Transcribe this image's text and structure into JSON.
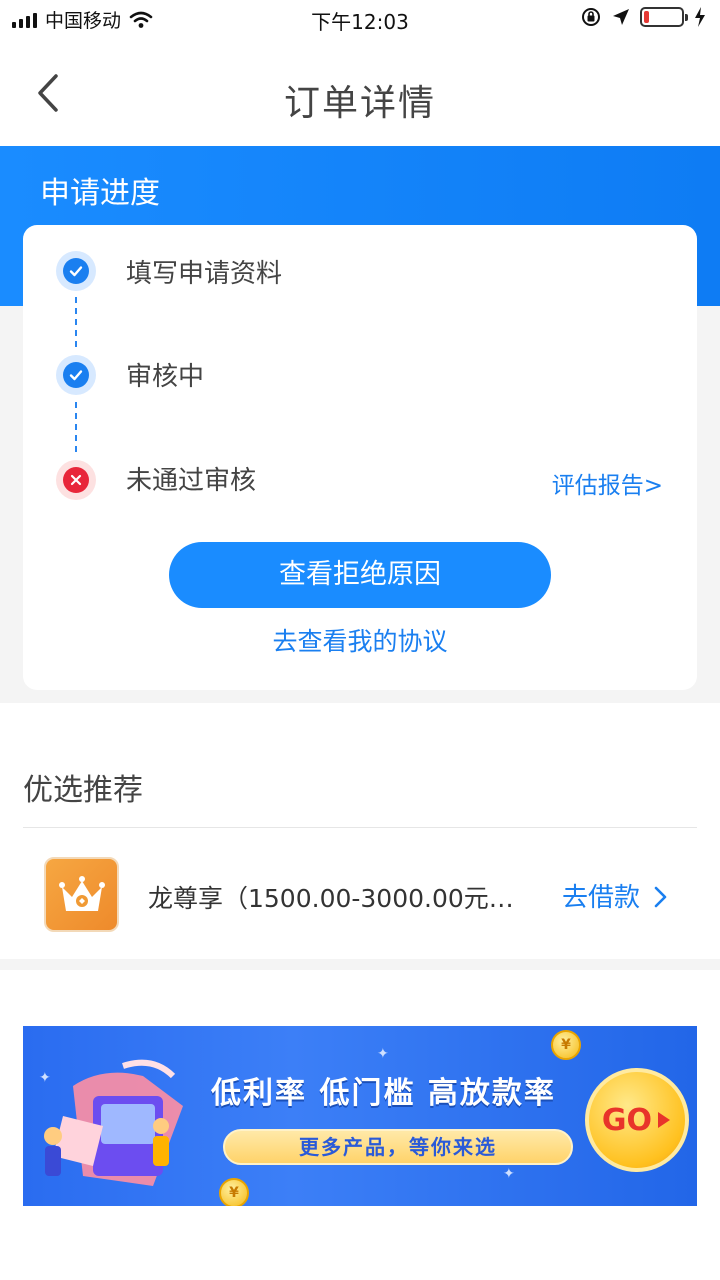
{
  "status_bar": {
    "carrier": "中国移动",
    "time": "下午12:03"
  },
  "nav": {
    "title": "订单详情"
  },
  "progress": {
    "section_title": "申请进度",
    "steps": [
      {
        "label": "填写申请资料",
        "state": "done"
      },
      {
        "label": "审核中",
        "state": "done"
      },
      {
        "label": "未通过审核",
        "state": "failed"
      }
    ],
    "report_link": "评估报告>",
    "reason_button": "查看拒绝原因",
    "agreement_link": "去查看我的协议"
  },
  "recommend": {
    "title": "优选推荐",
    "items": [
      {
        "name": "龙尊享（1500.00-3000.00元…",
        "action": "去借款"
      }
    ]
  },
  "banner": {
    "headline": "低利率 低门槛 高放款率",
    "subline": "更多产品，等你来选",
    "cta": "GO",
    "coin_symbol": "¥"
  },
  "colors": {
    "primary_blue": "#1a8cff",
    "link_blue": "#1a7ff0",
    "fail_red": "#e8263a",
    "logo_orange": "#f6a742"
  }
}
